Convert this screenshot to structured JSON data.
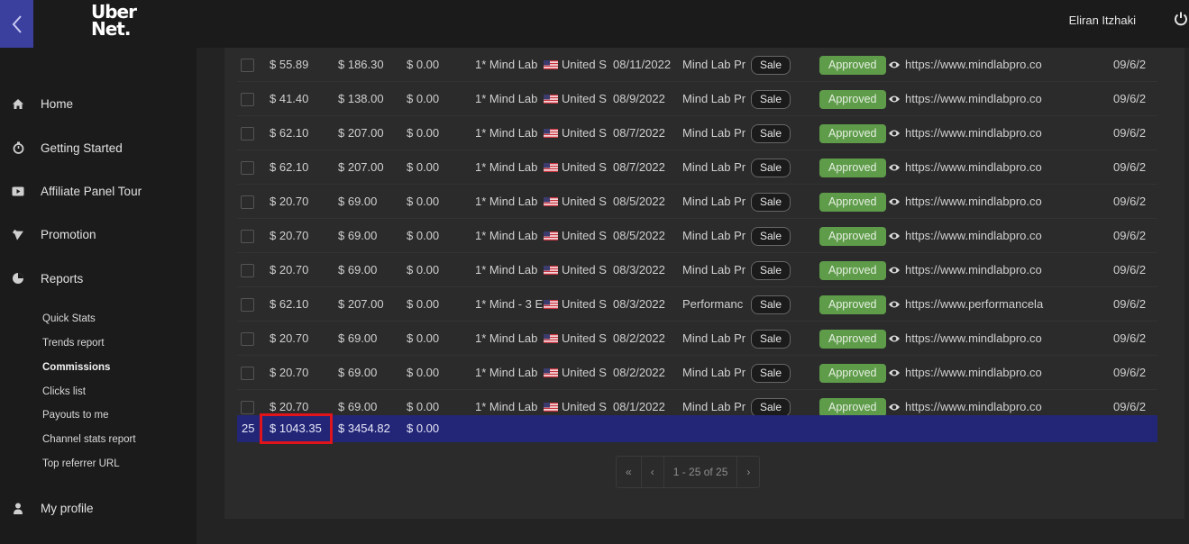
{
  "header": {
    "logo_line1": "Uber",
    "logo_line2": "Net.",
    "user_name": "Eliran Itzhaki"
  },
  "sidebar": {
    "items": [
      {
        "label": "Home",
        "icon": "home-icon"
      },
      {
        "label": "Getting Started",
        "icon": "stopwatch-icon"
      },
      {
        "label": "Affiliate Panel Tour",
        "icon": "video-icon"
      },
      {
        "label": "Promotion",
        "icon": "bullhorn-icon"
      },
      {
        "label": "Reports",
        "icon": "pie-chart-icon"
      },
      {
        "label": "My profile",
        "icon": "user-icon"
      }
    ],
    "report_subitems": [
      "Quick Stats",
      "Trends report",
      "Commissions",
      "Clicks list",
      "Payouts to me",
      "Channel stats report",
      "Top referrer URL"
    ],
    "active_subitem": "Commissions"
  },
  "table": {
    "rows": [
      {
        "commission": "$ 55.89",
        "amount": "$ 186.30",
        "other": "$ 0.00",
        "product": "1* Mind Lab",
        "country": "United S",
        "date": "08/11/2022",
        "program": "Mind Lab Pr",
        "type": "Sale",
        "status": "Approved",
        "url": "https://www.mindlabpro.co",
        "date2": "09/6/2"
      },
      {
        "commission": "$ 41.40",
        "amount": "$ 138.00",
        "other": "$ 0.00",
        "product": "1* Mind Lab",
        "country": "United S",
        "date": "08/9/2022",
        "program": "Mind Lab Pr",
        "type": "Sale",
        "status": "Approved",
        "url": "https://www.mindlabpro.co",
        "date2": "09/6/2"
      },
      {
        "commission": "$ 62.10",
        "amount": "$ 207.00",
        "other": "$ 0.00",
        "product": "1* Mind Lab",
        "country": "United S",
        "date": "08/7/2022",
        "program": "Mind Lab Pr",
        "type": "Sale",
        "status": "Approved",
        "url": "https://www.mindlabpro.co",
        "date2": "09/6/2"
      },
      {
        "commission": "$ 62.10",
        "amount": "$ 207.00",
        "other": "$ 0.00",
        "product": "1* Mind Lab",
        "country": "United S",
        "date": "08/7/2022",
        "program": "Mind Lab Pr",
        "type": "Sale",
        "status": "Approved",
        "url": "https://www.mindlabpro.co",
        "date2": "09/6/2"
      },
      {
        "commission": "$ 20.70",
        "amount": "$ 69.00",
        "other": "$ 0.00",
        "product": "1* Mind Lab",
        "country": "United S",
        "date": "08/5/2022",
        "program": "Mind Lab Pr",
        "type": "Sale",
        "status": "Approved",
        "url": "https://www.mindlabpro.co",
        "date2": "09/6/2"
      },
      {
        "commission": "$ 20.70",
        "amount": "$ 69.00",
        "other": "$ 0.00",
        "product": "1* Mind Lab",
        "country": "United S",
        "date": "08/5/2022",
        "program": "Mind Lab Pr",
        "type": "Sale",
        "status": "Approved",
        "url": "https://www.mindlabpro.co",
        "date2": "09/6/2"
      },
      {
        "commission": "$ 20.70",
        "amount": "$ 69.00",
        "other": "$ 0.00",
        "product": "1* Mind Lab",
        "country": "United S",
        "date": "08/3/2022",
        "program": "Mind Lab Pr",
        "type": "Sale",
        "status": "Approved",
        "url": "https://www.mindlabpro.co",
        "date2": "09/6/2"
      },
      {
        "commission": "$ 62.10",
        "amount": "$ 207.00",
        "other": "$ 0.00",
        "product": "1* Mind - 3 E",
        "country": "United S",
        "date": "08/3/2022",
        "program": "Performanc",
        "type": "Sale",
        "status": "Approved",
        "url": "https://www.performancela",
        "date2": "09/6/2"
      },
      {
        "commission": "$ 20.70",
        "amount": "$ 69.00",
        "other": "$ 0.00",
        "product": "1* Mind Lab",
        "country": "United S",
        "date": "08/2/2022",
        "program": "Mind Lab Pr",
        "type": "Sale",
        "status": "Approved",
        "url": "https://www.mindlabpro.co",
        "date2": "09/6/2"
      },
      {
        "commission": "$ 20.70",
        "amount": "$ 69.00",
        "other": "$ 0.00",
        "product": "1* Mind Lab",
        "country": "United S",
        "date": "08/2/2022",
        "program": "Mind Lab Pr",
        "type": "Sale",
        "status": "Approved",
        "url": "https://www.mindlabpro.co",
        "date2": "09/6/2"
      },
      {
        "commission": "$ 20.70",
        "amount": "$ 69.00",
        "other": "$ 0.00",
        "product": "1* Mind Lab",
        "country": "United S",
        "date": "08/1/2022",
        "program": "Mind Lab Pr",
        "type": "Sale",
        "status": "Approved",
        "url": "https://www.mindlabpro.co",
        "date2": "09/6/2"
      }
    ],
    "totals": {
      "count": "25",
      "commission": "$ 1043.35",
      "amount": "$ 3454.82",
      "other": "$ 0.00"
    }
  },
  "pagination": {
    "first": "«",
    "prev": "‹",
    "info": "1 - 25 of 25",
    "next": "›"
  },
  "colors": {
    "accent": "#3b3f9e",
    "totals_bg": "#232677",
    "approved": "#5e9c4a",
    "highlight": "#e0141b"
  }
}
